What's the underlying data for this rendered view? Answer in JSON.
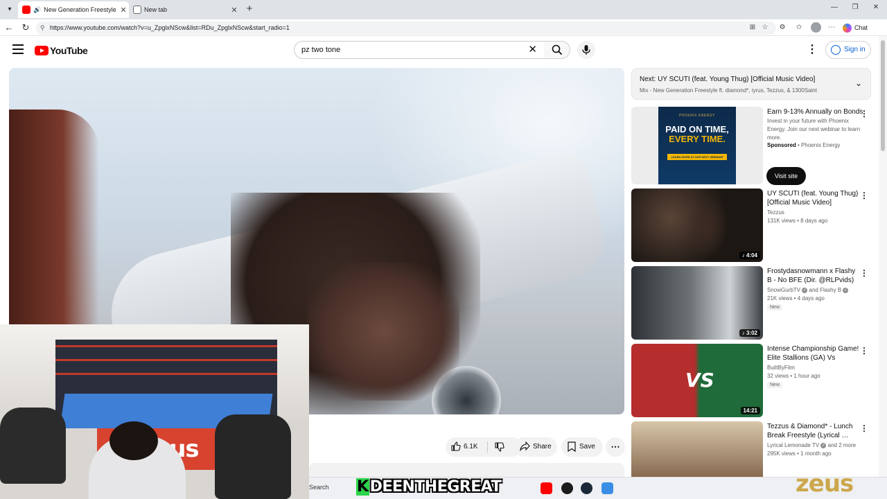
{
  "browser": {
    "tabs": [
      {
        "title": "New Generation Freestyle ft. d",
        "active": true
      },
      {
        "title": "New tab",
        "active": false
      }
    ],
    "url": "https://www.youtube.com/watch?v=u_ZpglxNScw&list=RDu_ZpglxNScw&start_radio=1",
    "chat_label": "Chat"
  },
  "header": {
    "logo_text": "YouTube",
    "search_value": "pz two tone",
    "signin_label": "Sign in"
  },
  "actions": {
    "likes": "6.1K",
    "share_label": "Share",
    "save_label": "Save"
  },
  "upnext": {
    "title": "Next: UY SCUTI (feat. Young Thug) [Official Music Video]",
    "subtitle": "Mix - New Generation Freestyle ft. diamond*, iyrus, Tezzus, & 1300Saint"
  },
  "ad": {
    "title": "Earn 9-13% Annually on Bonds",
    "body": "Invest in your future with Phoenix Energy. Join our next webinar to learn more.",
    "sponsored_label": "Sponsored",
    "advertiser": "Phoenix Energy",
    "cta_label": "Visit site",
    "poster": {
      "brand": "PHOENIX ENERGY",
      "line1": "PAID ON TIME,",
      "line2": "EVERY TIME.",
      "cta": "LEARN MORE AT OUR NEXT WEBINAR"
    }
  },
  "recommendations": [
    {
      "title": "UY SCUTI (feat. Young Thug) [Official Music Video]",
      "channel": "Tezzus",
      "meta": "131K views • 8 days ago",
      "duration": "4:04",
      "new": ""
    },
    {
      "title": "Frostydasnowmann x Flashy B - No BFE (Dir. @RLPvids)",
      "channel": "SnowGurbTV",
      "channel_extra": "and Flashy B",
      "meta": "21K views • 4 days ago",
      "duration": "3:02",
      "new": "New"
    },
    {
      "title": "Intense Championship Game! Elite Stallions (GA) Vs Tucker…",
      "channel": "BuiltByFilm",
      "meta": "32 views • 1 hour ago",
      "duration": "14:21",
      "new": "New"
    },
    {
      "title": "Tezzus & Diamond* - Lunch Break Freestyle (Lyrical …",
      "channel": "Lyrical Lemonade TV",
      "channel_extra": "and 2 more",
      "meta": "295K views • 1 month ago",
      "duration": "",
      "new": ""
    }
  ],
  "overlay": {
    "streamer_k": "K",
    "streamer_rest": "DEENTHEGREAT",
    "zeus": "zeus",
    "webcam_banner": "zeus"
  },
  "taskbar": {
    "search_label": "Search"
  }
}
